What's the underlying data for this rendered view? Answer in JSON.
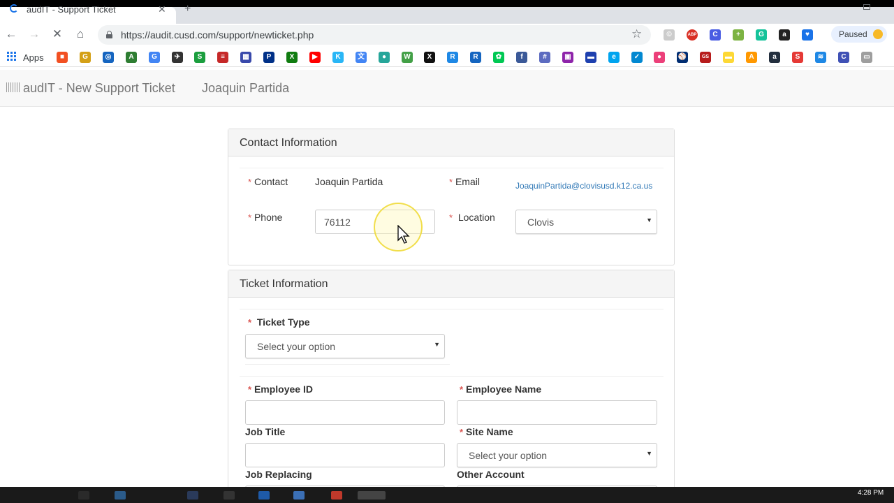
{
  "browser": {
    "tab_title": "audIT - Support Ticket",
    "new_tab_glyph": "+",
    "close_glyph": "✕",
    "url": "https://audit.cusd.com/support/newticket.php",
    "profile_label": "Paused",
    "extensions": [
      {
        "name": "c-ext-icon",
        "color": "#cccccc",
        "glyph": "©"
      },
      {
        "name": "adblock-icon",
        "color": "#d93025",
        "glyph": "ABP"
      },
      {
        "name": "c-blue-icon",
        "color": "#4a5de3",
        "glyph": "C"
      },
      {
        "name": "plus-green-icon",
        "color": "#7cb342",
        "glyph": "+"
      },
      {
        "name": "grammarly-icon",
        "color": "#15c39a",
        "glyph": "G"
      },
      {
        "name": "a-ext-icon",
        "color": "#222222",
        "glyph": "a"
      },
      {
        "name": "shield-icon",
        "color": "#1a73e8",
        "glyph": "♥"
      }
    ]
  },
  "bookmarks": {
    "apps_label": "Apps",
    "items": [
      {
        "name": "microsoft-icon",
        "color": "#f25022",
        "glyph": "■"
      },
      {
        "name": "g-gold-icon",
        "color": "#d4a017",
        "glyph": "G"
      },
      {
        "name": "globe-icon",
        "color": "#1565c0",
        "glyph": "◎"
      },
      {
        "name": "a-green-icon",
        "color": "#2e7d32",
        "glyph": "A"
      },
      {
        "name": "google-icon",
        "color": "#4285f4",
        "glyph": "G"
      },
      {
        "name": "plane-icon",
        "color": "#333333",
        "glyph": "✈"
      },
      {
        "name": "s-green-icon",
        "color": "#1b9e3e",
        "glyph": "S"
      },
      {
        "name": "red-bars-icon",
        "color": "#c62828",
        "glyph": "≡"
      },
      {
        "name": "building-icon",
        "color": "#3949ab",
        "glyph": "▦"
      },
      {
        "name": "playstation-icon",
        "color": "#003087",
        "glyph": "P"
      },
      {
        "name": "xbox-icon",
        "color": "#107c10",
        "glyph": "X"
      },
      {
        "name": "youtube-icon",
        "color": "#ff0000",
        "glyph": "▶"
      },
      {
        "name": "k-icon",
        "color": "#29b6f6",
        "glyph": "K"
      },
      {
        "name": "translate-icon",
        "color": "#4285f4",
        "glyph": "文"
      },
      {
        "name": "owl-icon",
        "color": "#26a69a",
        "glyph": "●"
      },
      {
        "name": "w-green-icon",
        "color": "#43a047",
        "glyph": "W"
      },
      {
        "name": "x-icon",
        "color": "#111111",
        "glyph": "X"
      },
      {
        "name": "r-blue-icon",
        "color": "#1e88e5",
        "glyph": "R"
      },
      {
        "name": "r-outline-icon",
        "color": "#1565c0",
        "glyph": "R"
      },
      {
        "name": "leaf-icon",
        "color": "#00c853",
        "glyph": "✿"
      },
      {
        "name": "facebook-icon",
        "color": "#3b5998",
        "glyph": "f"
      },
      {
        "name": "grid-globe-icon",
        "color": "#5c6bc0",
        "glyph": "#"
      },
      {
        "name": "photo-icon",
        "color": "#8e24aa",
        "glyph": "▣"
      },
      {
        "name": "cards-icon",
        "color": "#1e40af",
        "glyph": "▬"
      },
      {
        "name": "edge-icon",
        "color": "#00a4ef",
        "glyph": "e"
      },
      {
        "name": "check-blue-icon",
        "color": "#0288d1",
        "glyph": "✓"
      },
      {
        "name": "pig-icon",
        "color": "#ec407a",
        "glyph": "●"
      },
      {
        "name": "mlb-icon",
        "color": "#002d72",
        "glyph": "⚾"
      },
      {
        "name": "gs-icon",
        "color": "#b71c1c",
        "glyph": "GS"
      },
      {
        "name": "tag-yellow-icon",
        "color": "#fdd835",
        "glyph": "▬"
      },
      {
        "name": "a-orange-icon",
        "color": "#ff9800",
        "glyph": "A"
      },
      {
        "name": "amazon-icon",
        "color": "#232f3e",
        "glyph": "a"
      },
      {
        "name": "s-red-icon",
        "color": "#e53935",
        "glyph": "S"
      },
      {
        "name": "lines-icon",
        "color": "#1e88e5",
        "glyph": "≋"
      },
      {
        "name": "c-square-icon",
        "color": "#3f51b5",
        "glyph": "C"
      },
      {
        "name": "laptop-icon",
        "color": "#9e9e9e",
        "glyph": "▭"
      }
    ]
  },
  "header": {
    "brand": "audIT - New Support Ticket",
    "user": "Joaquin Partida"
  },
  "contact": {
    "title": "Contact Information",
    "req_mark": "*",
    "contact_label": "Contact",
    "contact_value": "Joaquin Partida",
    "email_label": "Email",
    "email_value": "JoaquinPartida@clovisusd.k12.ca.us",
    "phone_label": "Phone",
    "phone_value": "76112",
    "location_label": "Location",
    "location_value": "Clovis"
  },
  "ticket": {
    "title": "Ticket Information",
    "ticket_type_label": "Ticket Type",
    "ticket_type_value": "Select your option",
    "employee_id_label": "Employee ID",
    "employee_name_label": "Employee Name",
    "job_title_label": "Job Title",
    "site_name_label": "Site Name",
    "site_name_value": "Select your option",
    "job_replacing_label": "Job Replacing",
    "other_account_label": "Other Account"
  },
  "taskbar": {
    "clock": "4:28 PM"
  }
}
